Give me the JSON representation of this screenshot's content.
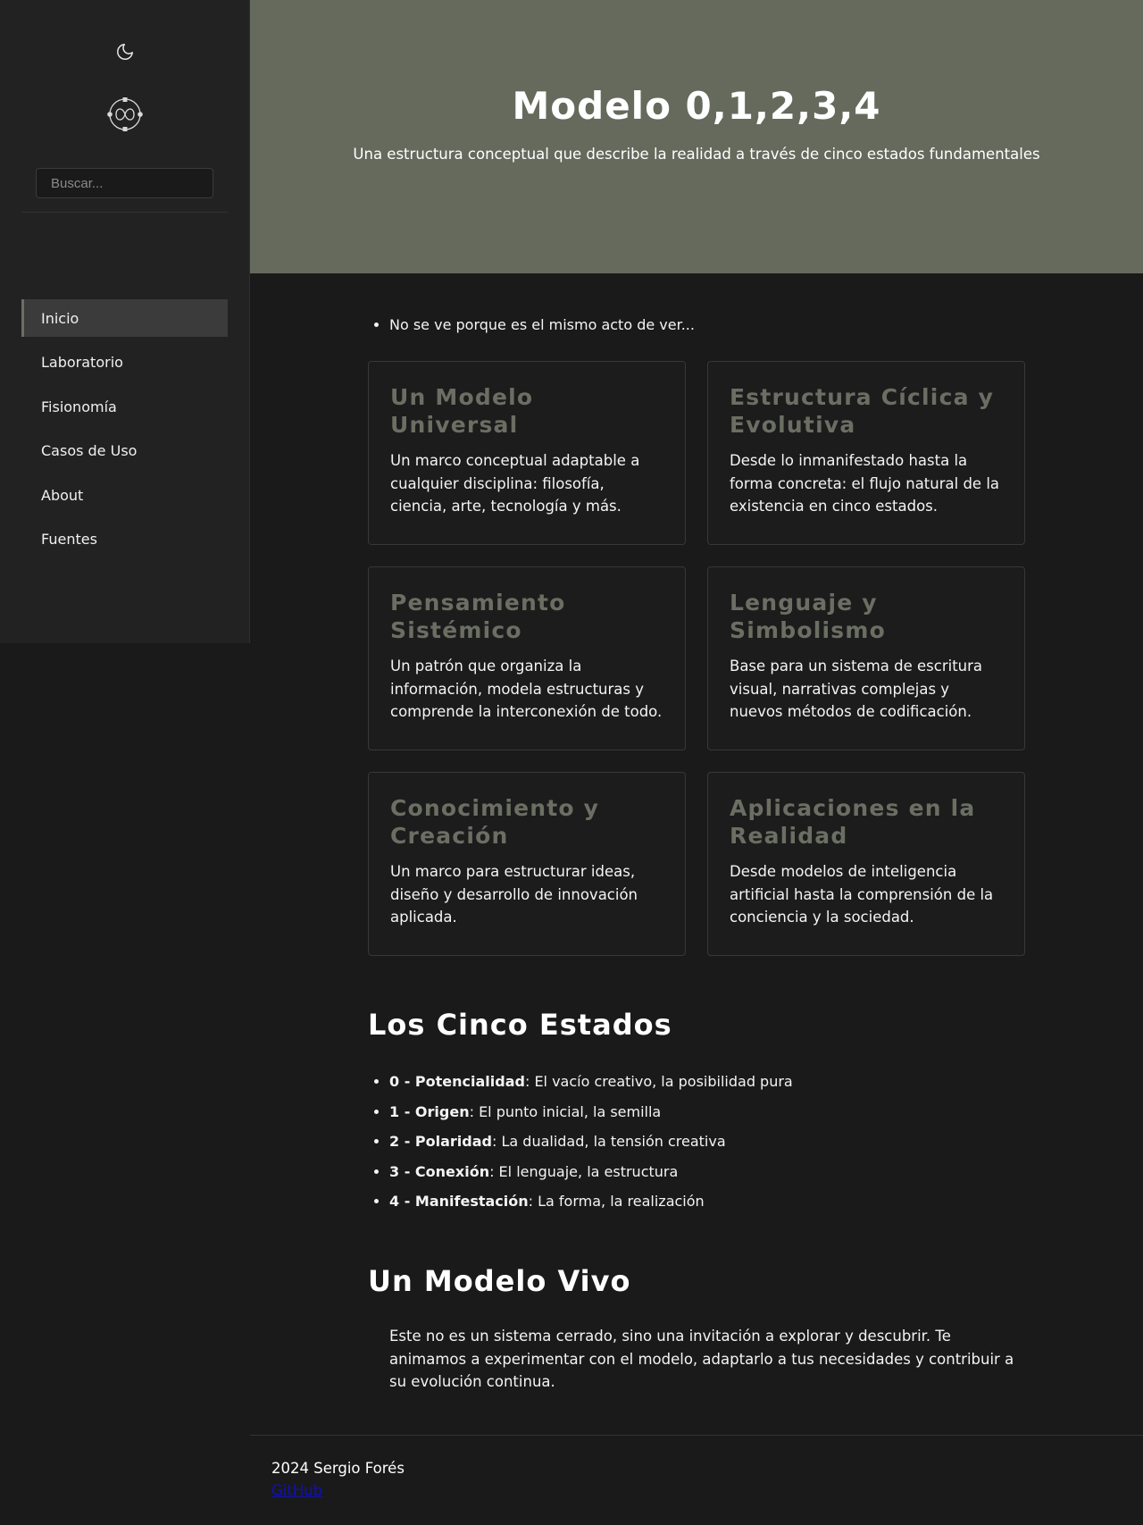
{
  "sidebar": {
    "theme_icon": "moon-icon",
    "logo_icon": "logo-icon",
    "search_placeholder": "Buscar...",
    "nav": [
      {
        "label": "Inicio",
        "active": true
      },
      {
        "label": "Laboratorio",
        "active": false
      },
      {
        "label": "Fisionomía",
        "active": false
      },
      {
        "label": "Casos de Uso",
        "active": false
      },
      {
        "label": "About",
        "active": false
      },
      {
        "label": "Fuentes",
        "active": false
      }
    ]
  },
  "hero": {
    "title": "Modelo 0,1,2,3,4",
    "subtitle": "Una estructura conceptual que describe la realidad a través de cinco estados fundamentales"
  },
  "intro": {
    "bullet": "No se ve porque es el mismo acto de ver..."
  },
  "cards": [
    {
      "title": "Un Modelo Universal",
      "text": "Un marco conceptual adaptable a cualquier disciplina: filosofía, ciencia, arte, tecnología y más."
    },
    {
      "title": "Estructura Cíclica y Evolutiva",
      "text": "Desde lo inmanifestado hasta la forma concreta: el flujo natural de la existencia en cinco estados."
    },
    {
      "title": "Pensamiento Sistémico",
      "text": "Un patrón que organiza la información, modela estructuras y comprende la interconexión de todo."
    },
    {
      "title": "Lenguaje y Simbolismo",
      "text": "Base para un sistema de escritura visual, narrativas complejas y nuevos métodos de codificación."
    },
    {
      "title": "Conocimiento y Creación",
      "text": "Un marco para estructurar ideas, diseño y desarrollo de innovación aplicada."
    },
    {
      "title": "Aplicaciones en la Realidad",
      "text": "Desde modelos de inteligencia artificial hasta la comprensión de la conciencia y la sociedad."
    }
  ],
  "states_section": {
    "title": "Los Cinco Estados",
    "items": [
      {
        "label": "0 - Potencialidad",
        "desc": ": El vacío creativo, la posibilidad pura"
      },
      {
        "label": "1 - Origen",
        "desc": ": El punto inicial, la semilla"
      },
      {
        "label": "2 - Polaridad",
        "desc": ": La dualidad, la tensión creativa"
      },
      {
        "label": "3 - Conexión",
        "desc": ": El lenguaje, la estructura"
      },
      {
        "label": "4 - Manifestación",
        "desc": ": La forma, la realización"
      }
    ]
  },
  "living_section": {
    "title": "Un Modelo Vivo",
    "text": "Este no es un sistema cerrado, sino una invitación a explorar y descubrir. Te animamos a experimentar con el modelo, adaptarlo a tus necesidades y contribuir a su evolución continua."
  },
  "footer": {
    "copyright": "2024 Sergio Forés",
    "link": "GitHub"
  },
  "colors": {
    "accent": "#6b6e63",
    "hero_bg": "#666a5d",
    "page_bg": "#1a1a1a",
    "sidebar_bg": "#222222"
  }
}
